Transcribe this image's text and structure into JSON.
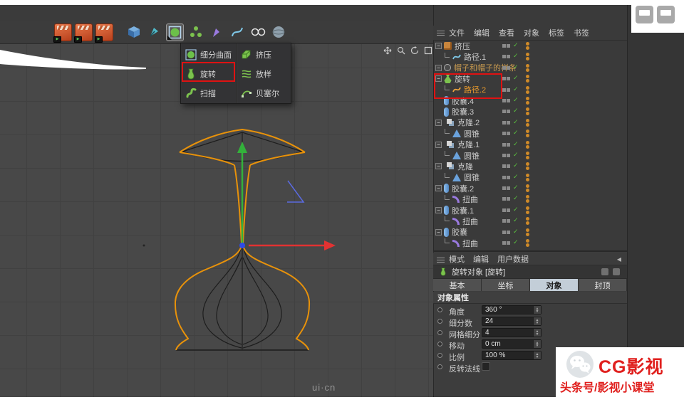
{
  "glyphs": {
    "expander": "−",
    "check": "✓",
    "play": "▶",
    "up": "▲",
    "down": "▼",
    "left": "◀"
  },
  "colors": {
    "accent_orange": "#e8920a",
    "annotation_red": "#e01212",
    "gizmo_green": "#33b13b",
    "gizmo_red": "#e23232",
    "gizmo_blue": "#2e4be8",
    "check_green": "#5abf3e",
    "dot_amber": "#cf8a28",
    "tab_active_bg": "#c3ced8"
  },
  "toolbar": {
    "icons": [
      "render-icon-1",
      "render-icon-2",
      "render-icon-3",
      "cube-icon",
      "pen-tool-icon",
      "subdivision-surface-icon",
      "array-icon",
      "spline-pen-icon",
      "spline-arc-icon",
      "circle-pair-icon",
      "sphere-icon"
    ]
  },
  "generator_menu": {
    "left": [
      {
        "label": "细分曲面",
        "icon": "subdivision-surface-icon"
      },
      {
        "label": "旋转",
        "icon": "lathe-icon",
        "annotated": true
      },
      {
        "label": "扫描",
        "icon": "sweep-icon"
      }
    ],
    "right": [
      {
        "label": "挤压",
        "icon": "extrude-icon"
      },
      {
        "label": "放样",
        "icon": "loft-icon"
      },
      {
        "label": "贝塞尔",
        "icon": "bezier-icon"
      }
    ]
  },
  "viewport": {
    "controls": [
      "pan-icon",
      "zoom-icon",
      "rotate-icon",
      "maximize-icon"
    ]
  },
  "object_manager": {
    "menu": [
      "文件",
      "编辑",
      "查看",
      "对象",
      "标签",
      "书签"
    ],
    "items": [
      {
        "label": "挤压",
        "type": "extrude"
      },
      {
        "label": "路径.1",
        "type": "spline"
      },
      {
        "label": "帽子和帽子的样条",
        "type": "group"
      },
      {
        "label": "旋转",
        "type": "lathe"
      },
      {
        "label": "路径.2",
        "type": "spline"
      },
      {
        "label": "胶囊.4",
        "type": "capsule"
      },
      {
        "label": "胶囊.3",
        "type": "capsule"
      },
      {
        "label": "克隆.2",
        "type": "clone"
      },
      {
        "label": "圆锥",
        "type": "cone"
      },
      {
        "label": "克隆.1",
        "type": "clone"
      },
      {
        "label": "圆锥",
        "type": "cone"
      },
      {
        "label": "克隆",
        "type": "clone"
      },
      {
        "label": "圆锥",
        "type": "cone"
      },
      {
        "label": "胶囊.2",
        "type": "capsule"
      },
      {
        "label": "扭曲",
        "type": "bend"
      },
      {
        "label": "胶囊.1",
        "type": "capsule"
      },
      {
        "label": "扭曲",
        "type": "bend"
      },
      {
        "label": "胶囊",
        "type": "capsule"
      },
      {
        "label": "扭曲",
        "type": "bend"
      }
    ]
  },
  "attribute_manager": {
    "menu": [
      "模式",
      "编辑",
      "用户数据"
    ],
    "title": "旋转对象 [旋转]",
    "tabs": [
      "基本",
      "坐标",
      "对象",
      "封顶"
    ],
    "active_tab": "对象",
    "section": "对象属性",
    "properties": [
      {
        "label": "角度",
        "value": "360 °",
        "type": "spinner"
      },
      {
        "label": "细分数",
        "value": "24",
        "type": "spinner"
      },
      {
        "label": "网格细分",
        "value": "4",
        "type": "spinner"
      },
      {
        "label": "移动",
        "value": "0 cm",
        "type": "spinner"
      },
      {
        "label": "比例",
        "value": "100 %",
        "type": "spinner"
      },
      {
        "label": "反转法线",
        "value": "",
        "type": "checkbox"
      }
    ]
  },
  "watermark": "ui·cn",
  "branding": {
    "name": "CG影视",
    "subtitle": "头条号/影视小课堂",
    "icon": "wechat-icon"
  }
}
